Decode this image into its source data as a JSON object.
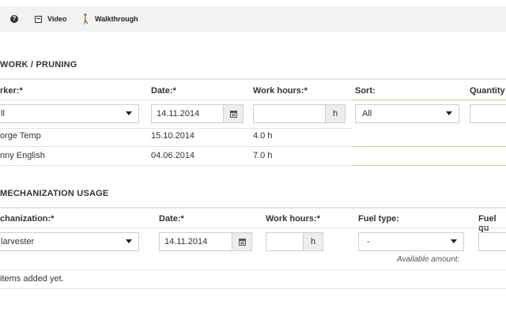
{
  "toolbar": {
    "help_icon": "question-circle-icon",
    "video_label": "Video",
    "video_icon": "film-icon",
    "walkthrough_label": "Walkthrough",
    "walkthrough_icon": "walking-person-icon"
  },
  "work_section": {
    "title": "WORK / PRUNING",
    "headers": {
      "worker": "rker:*",
      "date": "Date:*",
      "hours": "Work hours:*",
      "sort": "Sort:",
      "quantity": "Quantity"
    },
    "filters": {
      "worker_value": "ll",
      "date_value": "14.11.2014",
      "hours_value": "",
      "hours_unit": "h",
      "sort_value": "All",
      "quantity_value": ""
    },
    "rows": [
      {
        "worker": "orge Temp",
        "date": "15.10.2014",
        "hours": "4.0 h"
      },
      {
        "worker": "nny English",
        "date": "04.06.2014",
        "hours": "7.0 h"
      }
    ]
  },
  "mech_section": {
    "title": "MECHANIZATION USAGE",
    "headers": {
      "mechanization": "chanization:*",
      "date": "Date:*",
      "hours": "Work hours:*",
      "fuel_type": "Fuel type:",
      "fuel_quantity": "Fuel qu"
    },
    "filters": {
      "mechanization_value": "larvester",
      "date_value": "14.11.2014",
      "hours_value": "",
      "hours_unit": "h",
      "fuel_type_value": "-",
      "fuel_quantity_value": ""
    },
    "available_amount_label": "Available amount:",
    "empty_message": "items added yet."
  },
  "colors": {
    "accent_line": "#e8c77a",
    "toolbar_bg": "#f2f2f2",
    "border": "#cfcfcf"
  }
}
